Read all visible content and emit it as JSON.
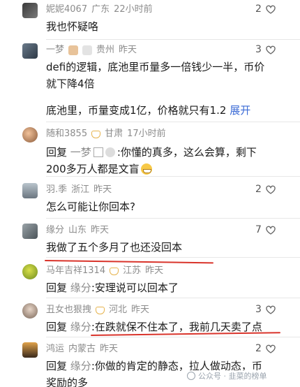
{
  "comments": [
    {
      "username": "妮妮4067",
      "location": "广东",
      "time": "22小时前",
      "likes": "2",
      "text": "我也怀疑咯"
    },
    {
      "username": "一梦",
      "location": "贵州",
      "time": "昨天",
      "likes": "3",
      "text": "defi的逻辑，底池里币量多一倍钱少一半，币价就下降4倍",
      "text2": "底池里，币量变成1亿，价格就只有1.2",
      "expand": "展开"
    },
    {
      "username": "随和3855",
      "location": "甘肃",
      "time": "17小时前",
      "likes": "",
      "reply_prefix": "回复",
      "reply_to": "一梦",
      "text": ":你懂的真多，这么会算，剩下200多万人都是文盲"
    },
    {
      "username": "羽.季",
      "location": "浙江",
      "time": "昨天",
      "likes": "2",
      "text": "怎么可能让你回本?"
    },
    {
      "username": "缘分",
      "location": "山东",
      "time": "昨天",
      "likes": "7",
      "text": "我做了五个多月了也还没回本"
    },
    {
      "username": "马年吉祥1314",
      "location": "江苏",
      "time": "昨天",
      "likes": "",
      "reply_prefix": "回复",
      "reply_to": "缘分",
      "text": ":安理说可以回本了"
    },
    {
      "username": "丑女也狠拽",
      "location": "河北",
      "time": "昨天",
      "likes": "3",
      "reply_prefix": "回复",
      "reply_to": "缘分",
      "text": ":在跌就保不住本了，我前几天卖了点"
    },
    {
      "username": "鸿运",
      "location": "内蒙古",
      "time": "昨天",
      "likes": "2",
      "reply_prefix": "回复",
      "reply_to": "缘分",
      "text": ":你做的肯定的静态，拉人做动态，币奖励的多"
    }
  ],
  "watermark": "公众号 · 韭菜的榜单",
  "colors": {
    "meta": "#8c8c8c",
    "link": "#3b6bd6",
    "annotation": "#d9342b"
  }
}
